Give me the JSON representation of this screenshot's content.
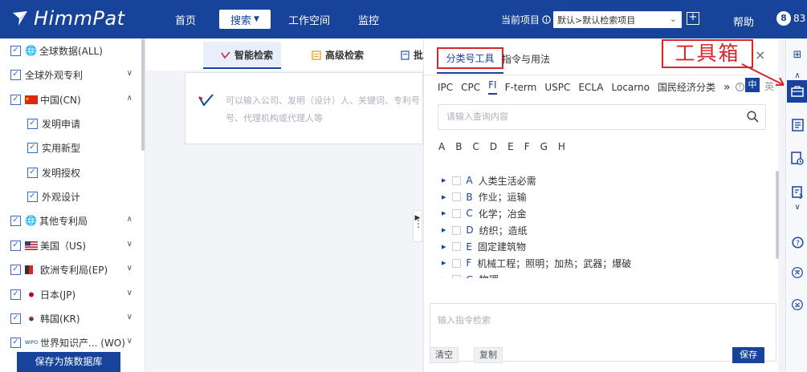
{
  "app": {
    "name": "HimmPat"
  },
  "nav": {
    "home": "首页",
    "search": "搜索",
    "workspace": "工作空间",
    "monitor": "监控"
  },
  "project": {
    "label": "当前项目",
    "selected": "默认>默认检索项目",
    "help": "帮助",
    "badge_count": "8",
    "badge_suffix": "83"
  },
  "sidebar": {
    "items": [
      {
        "label": "全球数据(ALL)",
        "checked": true
      },
      {
        "label": "全球外观专利",
        "checked": true
      },
      {
        "label": "中国(CN)",
        "checked": true
      },
      {
        "label": "发明申请",
        "checked": true
      },
      {
        "label": "实用新型",
        "checked": true
      },
      {
        "label": "发明授权",
        "checked": true
      },
      {
        "label": "外观设计",
        "checked": true
      },
      {
        "label": "其他专利局",
        "checked": true
      },
      {
        "label": "美国（US)",
        "checked": true
      },
      {
        "label": "欧洲专利局(EP)",
        "checked": true
      },
      {
        "label": "日本(JP)",
        "checked": true
      },
      {
        "label": "韩国(KR)",
        "checked": true
      },
      {
        "label": "世界知识产... (WO)",
        "checked": true
      }
    ],
    "wipo_tag": "WIPO",
    "save_button": "保存为族数据库"
  },
  "search_tabs": {
    "smart": "智能检索",
    "advanced": "高级检索",
    "batch": "批"
  },
  "search": {
    "placeholder_line1": "可以输入公司、发明（设计）人、关键词、专利号",
    "placeholder_line2": "号、代理机构或代理人等"
  },
  "panel": {
    "tab_classification": "分类号工具",
    "tab_commands": "指令与用法",
    "annotation": "工具箱",
    "class_tabs": [
      "IPC",
      "CPC",
      "FI",
      "F-term",
      "USPC",
      "ECLA",
      "Locarno",
      "国民经济分类"
    ],
    "active_class_tab": "FI",
    "more": "»",
    "help_glyph": "?",
    "lang_zh": "中",
    "lang_en": "英",
    "query_placeholder": "请输入查询内容",
    "letters": [
      "A",
      "B",
      "C",
      "D",
      "E",
      "F",
      "G",
      "H"
    ],
    "tree": [
      {
        "code": "A",
        "label": "人类生活必需"
      },
      {
        "code": "B",
        "label": "作业；运输"
      },
      {
        "code": "C",
        "label": "化学；冶金"
      },
      {
        "code": "D",
        "label": "纺织；造纸"
      },
      {
        "code": "E",
        "label": "固定建筑物"
      },
      {
        "code": "F",
        "label": "机械工程；照明；加热；武器；爆破"
      },
      {
        "code": "G",
        "label": "物理"
      }
    ],
    "command_placeholder": "输入指令检索",
    "clear_button": "清空",
    "copy_button": "复制",
    "save_button": "保存"
  },
  "colors": {
    "brand": "#17449a",
    "annotation_red": "#d9262b"
  }
}
